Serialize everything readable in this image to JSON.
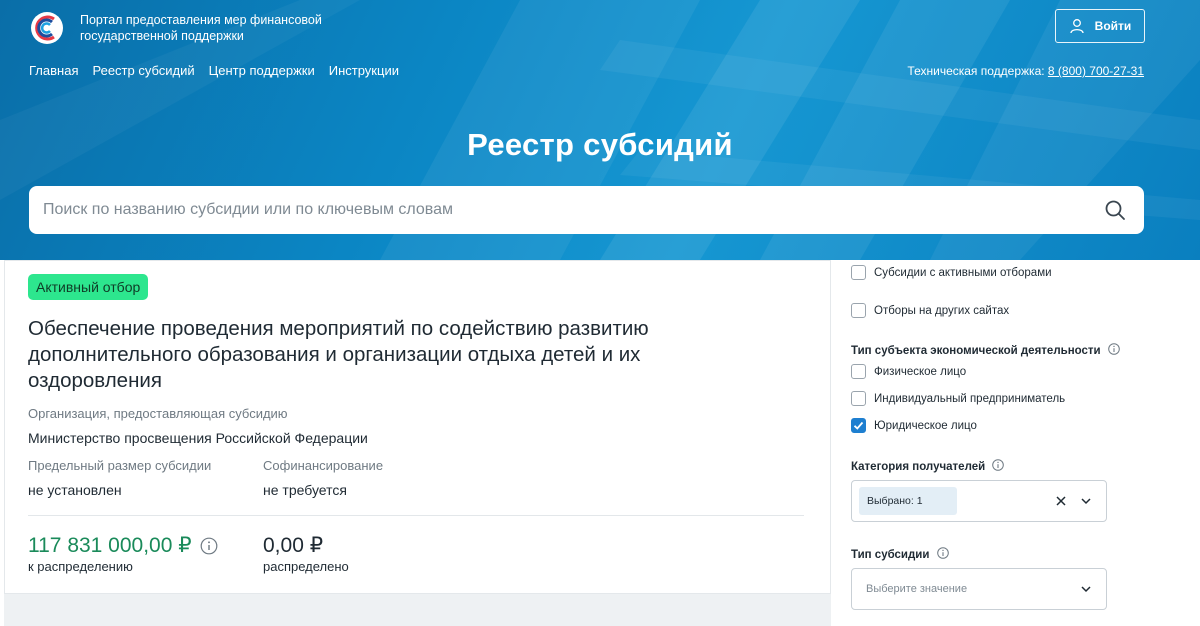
{
  "header": {
    "portal_title": "Портал предоставления мер финансовой государственной поддержки",
    "login_label": "Войти",
    "nav": [
      {
        "label": "Главная"
      },
      {
        "label": "Реестр субсидий"
      },
      {
        "label": "Центр поддержки"
      },
      {
        "label": "Инструкции"
      }
    ],
    "support_label": "Техническая поддержка:",
    "support_phone": "8 (800) 700-27-31",
    "page_title": "Реестр субсидий",
    "search_placeholder": "Поиск по названию субсидии или по ключевым словам"
  },
  "card": {
    "badge": "Активный отбор",
    "title": "Обеспечение проведения мероприятий по содействию развитию дополнительного образования и организации отдыха детей и их оздоровления",
    "org_label": "Организация, предоставляющая субсидию",
    "org_value": "Министерство просвещения Российской Федерации",
    "limit_label": "Предельный размер субсидии",
    "limit_value": "не установлен",
    "cofin_label": "Софинансирование",
    "cofin_value": "не требуется",
    "to_distribute_amount": "117 831 000,00 ₽",
    "to_distribute_label": "к распределению",
    "distributed_amount": "0,00 ₽",
    "distributed_label": "распределено"
  },
  "filters": {
    "active_selections": {
      "label": "Субсидии с активными отборами",
      "checked": false
    },
    "other_sites": {
      "label": "Отборы на других сайтах",
      "checked": false
    },
    "subject_type_title": "Тип субъекта экономической деятельности",
    "subject_types": [
      {
        "label": "Физическое лицо",
        "checked": false
      },
      {
        "label": "Индивидуальный предприниматель",
        "checked": false
      },
      {
        "label": "Юридическое лицо",
        "checked": true
      }
    ],
    "recipient_category_title": "Категория получателей",
    "recipient_category_chip": "Выбрано: 1",
    "subsidy_type_title": "Тип субсидии",
    "subsidy_type_placeholder": "Выберите значение"
  },
  "colors": {
    "brand_blue": "#0b86c4",
    "badge_green": "#2de68e",
    "amount_green": "#1a8a5a",
    "checkbox_blue": "#1e7fd0"
  }
}
